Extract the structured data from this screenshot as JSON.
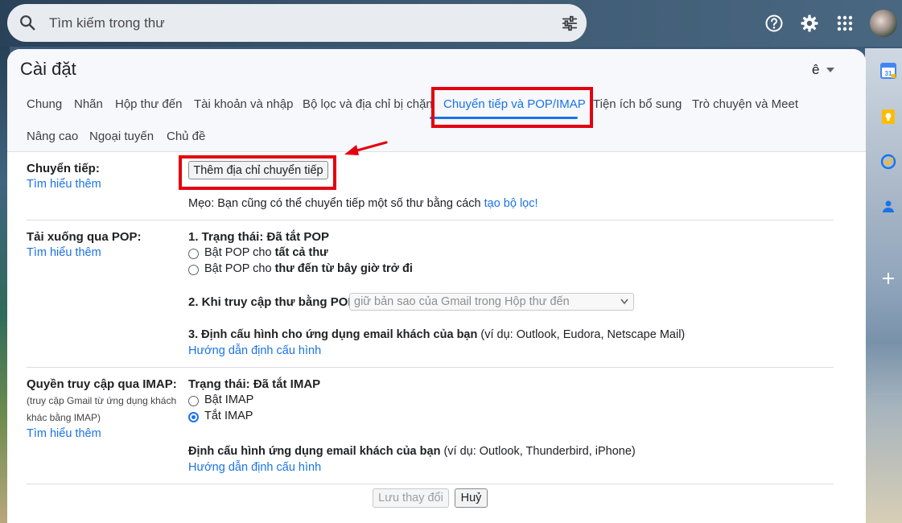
{
  "search": {
    "placeholder": "Tìm kiếm trong thư"
  },
  "header": {
    "title": "Cài đặt",
    "lang_label": "ê"
  },
  "tabs": [
    {
      "label": "Chung"
    },
    {
      "label": "Nhãn"
    },
    {
      "label": "Hộp thư đến"
    },
    {
      "label": "Tài khoản và nhập"
    },
    {
      "label": "Bộ lọc và địa chỉ bị chặn"
    },
    {
      "label": "Chuyển tiếp và POP/IMAP",
      "active": true
    },
    {
      "label": "Tiện ích bổ sung"
    },
    {
      "label": "Trò chuyện và Meet"
    },
    {
      "label": "Nâng cao"
    },
    {
      "label": "Ngoại tuyến"
    },
    {
      "label": "Chủ đề"
    }
  ],
  "forwarding": {
    "label": "Chuyển tiếp:",
    "learn_more": "Tìm hiểu thêm",
    "add_button": "Thêm địa chỉ chuyển tiếp",
    "tip_prefix": "Mẹo: Bạn cũng có thể chuyển tiếp một số thư bằng cách",
    "tip_link": "tạo bộ lọc!"
  },
  "pop": {
    "label": "Tải xuống qua POP:",
    "learn_more": "Tìm hiểu thêm",
    "status": "1. Trạng thái: Đã tắt POP",
    "option_all_prefix": "Bật POP cho",
    "option_all_bold": "tất cả thư",
    "option_now_prefix": "Bật POP cho",
    "option_now_bold": "thư đến từ bây giờ trở đi",
    "access_label": "2. Khi truy cập thư bằng POP",
    "access_select": "giữ bản sao của Gmail trong Hộp thư đến",
    "config_label": "3. Định cấu hình cho ứng dụng email khách của bạn",
    "config_example": "(ví dụ: Outlook, Eudora, Netscape Mail)",
    "config_link": "Hướng dẫn định cấu hình"
  },
  "imap": {
    "label": "Quyền truy cập qua IMAP:",
    "sub1": "(truy cập Gmail từ ứng dụng khách",
    "sub2": "khác bằng IMAP)",
    "learn_more": "Tìm hiểu thêm",
    "status": "Trạng thái: Đã tắt IMAP",
    "option_on": "Bật IMAP",
    "option_off": "Tắt IMAP",
    "config_label": "Định cấu hình ứng dụng email khách của bạn",
    "config_example": "(ví dụ: Outlook, Thunderbird, iPhone)",
    "config_link": "Hướng dẫn định cấu hình"
  },
  "footer": {
    "save": "Lưu thay đổi",
    "cancel": "Huỷ"
  },
  "colors": {
    "accent": "#1a73e8",
    "highlight": "#e4000f"
  }
}
